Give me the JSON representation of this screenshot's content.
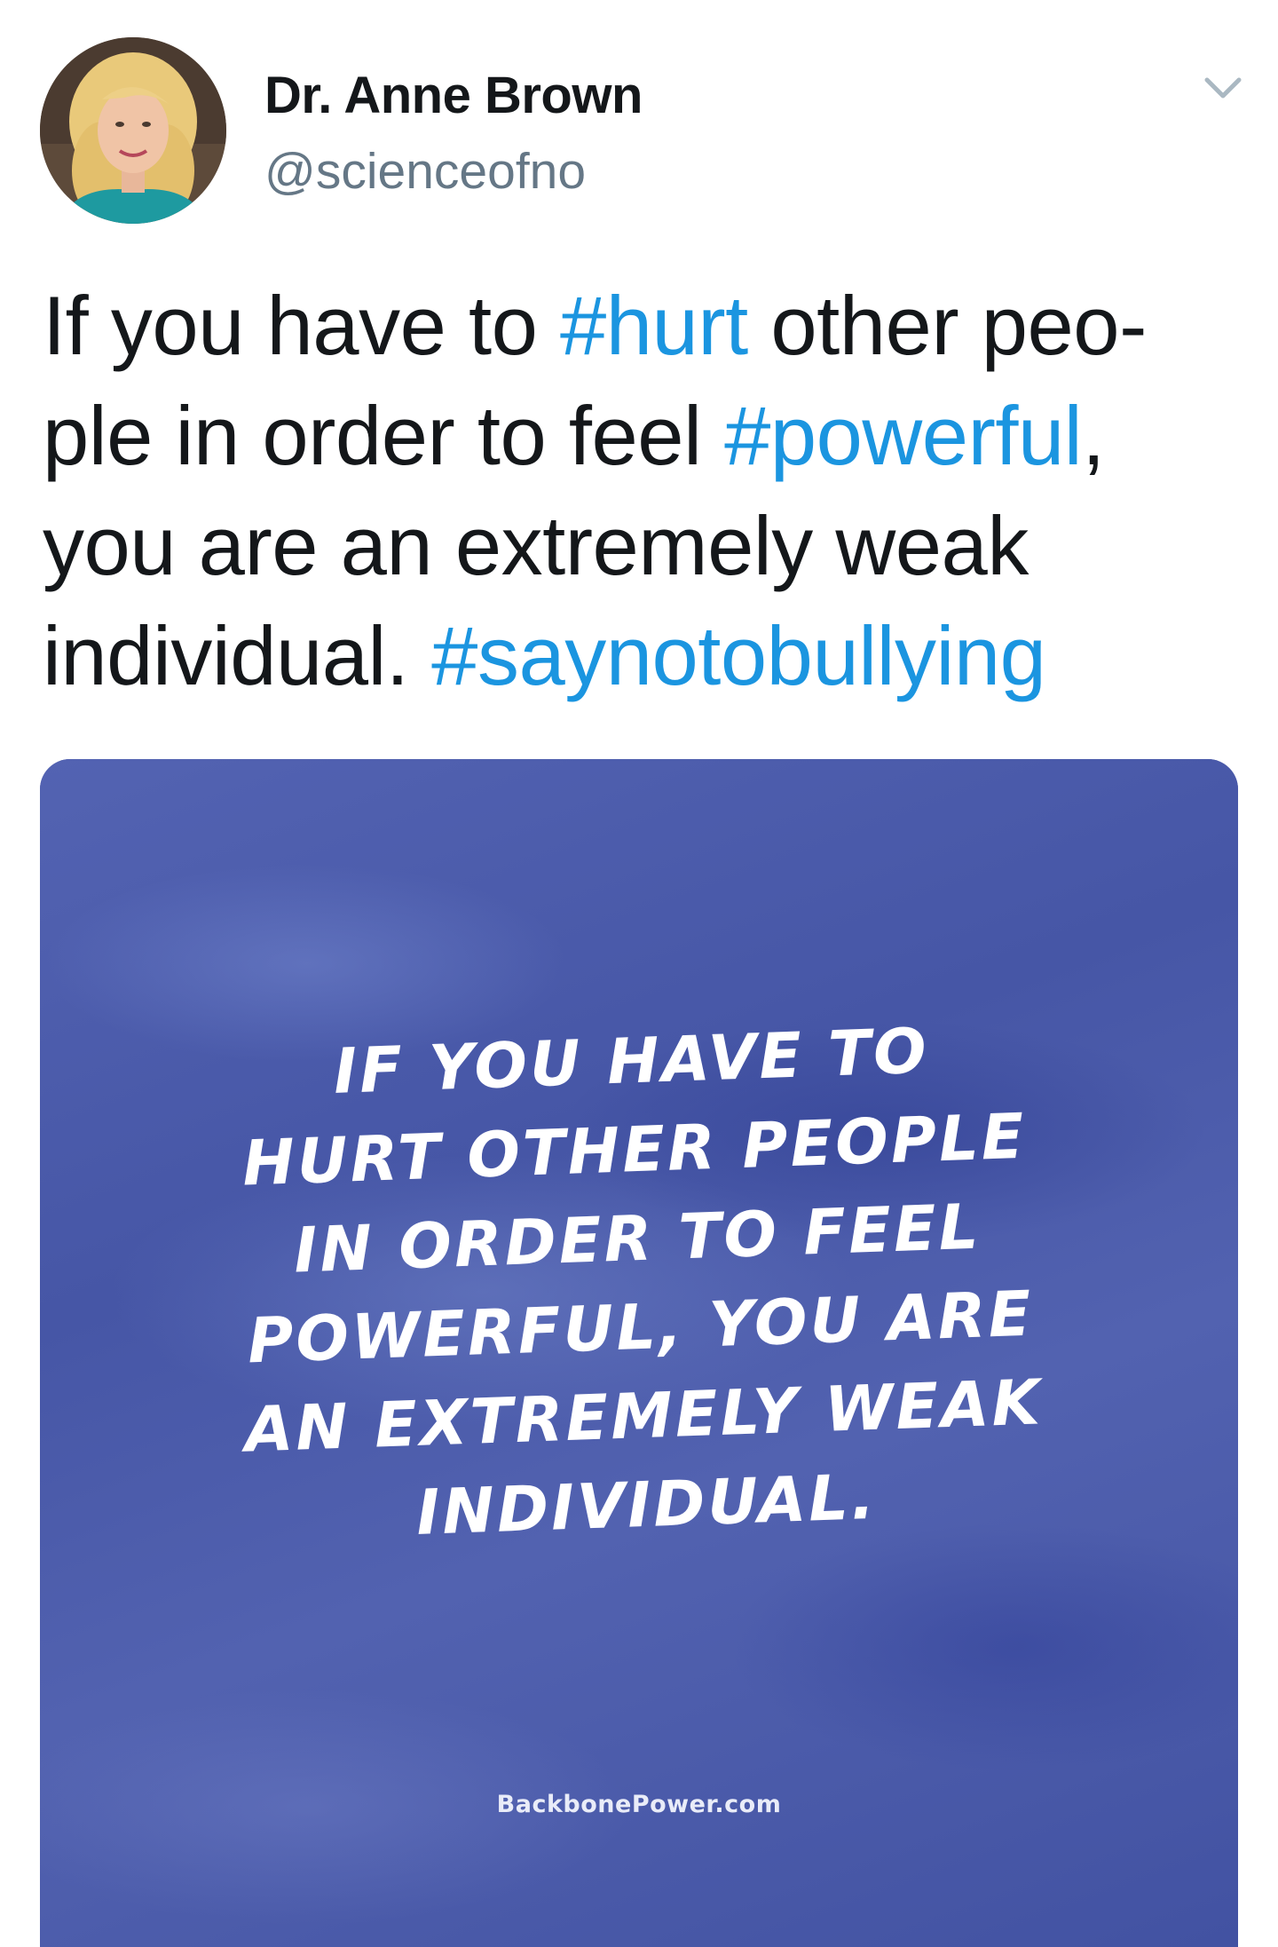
{
  "author": {
    "name": "Dr. Anne Brown",
    "handle": "@scienceofno",
    "avatar_icon": "profile-photo"
  },
  "menu": {
    "icon": "chevron-down-icon"
  },
  "tweet": {
    "segments": {
      "l1a": "If you have to ",
      "l1b": "#hurt",
      "l1c": " other peo-",
      "l2a": "ple in order to feel ",
      "l2b": "#powerful",
      "l2c": ",",
      "l3": "you are an extremely weak",
      "l4a": "individual. ",
      "l4b": "#saynotobullying"
    },
    "hashtag_color": "#1b95e0"
  },
  "media": {
    "quote_lines": [
      "IF YOU HAVE TO",
      "HURT OTHER PEOPLE",
      "IN ORDER TO FEEL",
      "POWERFUL, YOU ARE",
      "AN EXTREMELY WEAK",
      "INDIVIDUAL."
    ],
    "watermark": "BackbonePower.com",
    "background_color": "#4a5aa8"
  }
}
